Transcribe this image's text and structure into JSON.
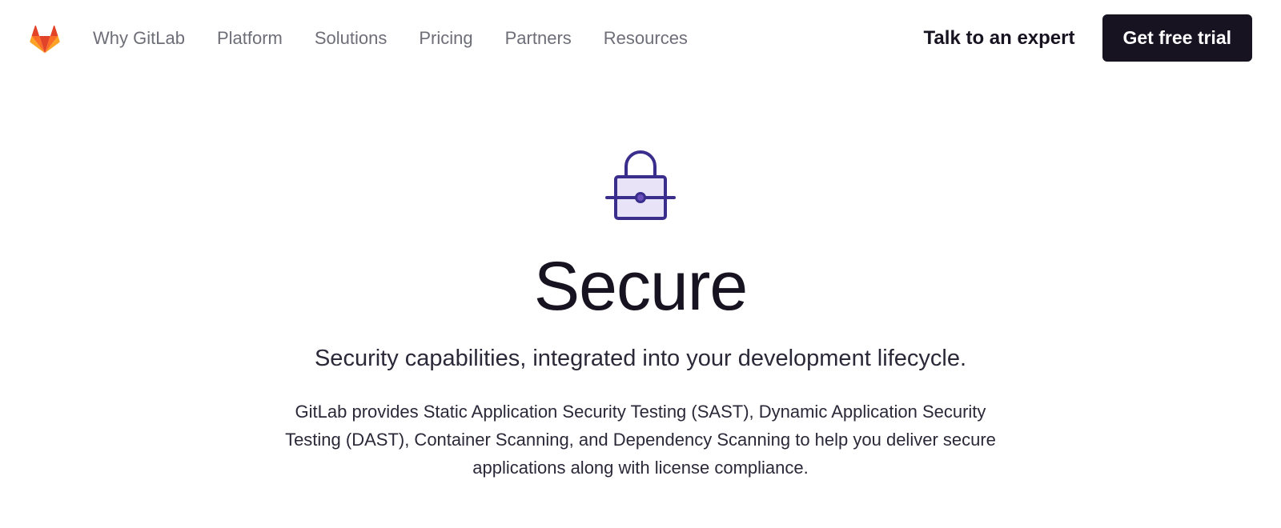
{
  "nav": {
    "items": [
      "Why GitLab",
      "Platform",
      "Solutions",
      "Pricing",
      "Partners",
      "Resources"
    ]
  },
  "header": {
    "expert_label": "Talk to an expert",
    "trial_label": "Get free trial"
  },
  "hero": {
    "title": "Secure",
    "subtitle": "Security capabilities, integrated into your development lifecycle.",
    "body": "GitLab provides Static Application Security Testing (SAST), Dynamic Application Security Testing (DAST), Container Scanning, and Dependency Scanning to help you deliver secure applications along with license compliance."
  }
}
